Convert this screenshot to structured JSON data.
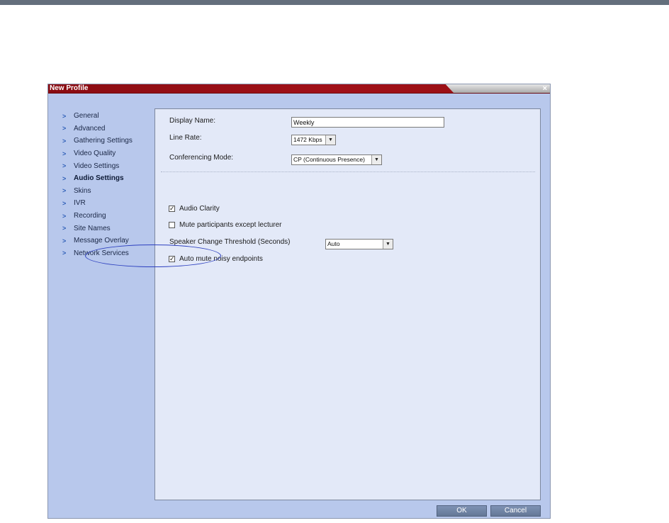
{
  "dialog": {
    "title": "New Profile",
    "close_glyph": "×"
  },
  "nav": {
    "items": [
      {
        "label": "General"
      },
      {
        "label": "Advanced"
      },
      {
        "label": "Gathering Settings"
      },
      {
        "label": "Video Quality"
      },
      {
        "label": "Video Settings"
      },
      {
        "label": "Audio Settings",
        "active": true
      },
      {
        "label": "Skins"
      },
      {
        "label": "IVR"
      },
      {
        "label": "Recording"
      },
      {
        "label": "Site Names"
      },
      {
        "label": "Message Overlay"
      },
      {
        "label": "Network Services"
      }
    ],
    "chevron_icon": "chevron-right-icon"
  },
  "form": {
    "display_name_label": "Display Name:",
    "display_name_value": "Weekly",
    "line_rate_label": "Line Rate:",
    "line_rate_value": "1472 Kbps",
    "conferencing_mode_label": "Conferencing Mode:",
    "conferencing_mode_value": "CP (Continuous Presence)",
    "audio_clarity_label": "Audio Clarity",
    "audio_clarity_checked": true,
    "mute_participants_label": "Mute participants except lecturer",
    "mute_participants_checked": false,
    "speaker_threshold_label": "Speaker Change Threshold (Seconds)",
    "speaker_threshold_value": "Auto",
    "auto_mute_label": "Auto mute noisy endpoints",
    "auto_mute_checked": true
  },
  "buttons": {
    "ok_label": "OK",
    "cancel_label": "Cancel"
  },
  "colors": {
    "titlebar": "#a01018",
    "dialog_bg": "#b8c8ec",
    "content_bg": "#e3e9f8",
    "highlight_ellipse": "#2c3fbf",
    "button": "#7388aa"
  }
}
